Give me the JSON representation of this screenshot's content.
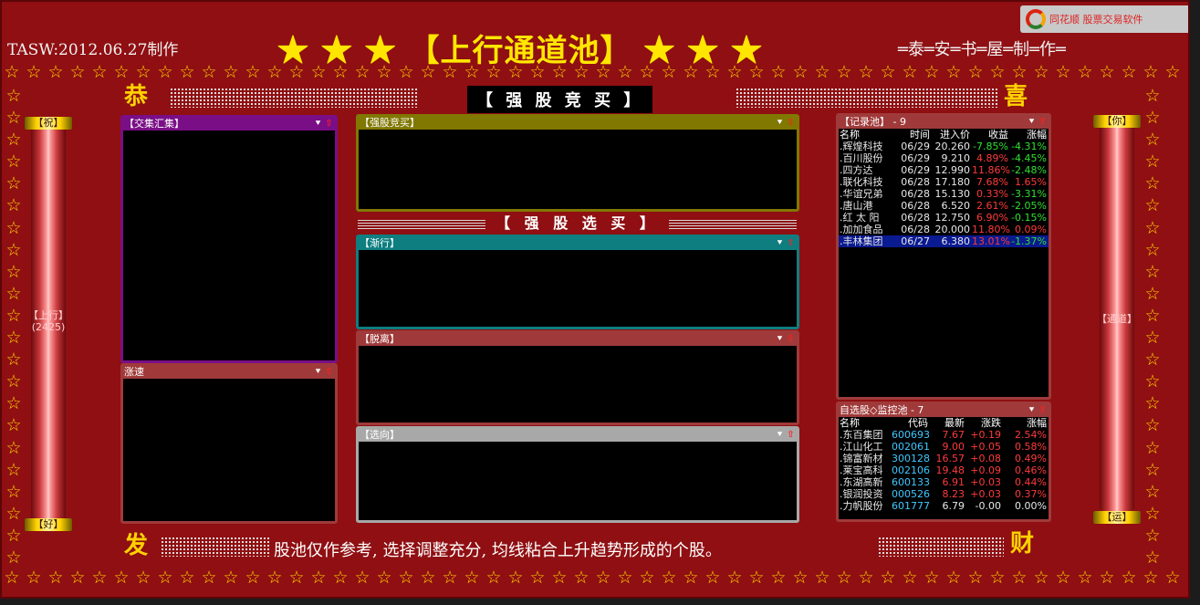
{
  "header": {
    "left_text": "TASW:2012.06.27制作",
    "title": "★ ★ ★ 【上行通道池】 ★ ★ ★",
    "right_text": "═泰═安═书═屋═制═作═",
    "logo_text": "同花顺 股票交易软件"
  },
  "corners": {
    "top_left": "恭",
    "top_right": "喜",
    "bottom_left": "发",
    "bottom_right": "财"
  },
  "badge_top": "【 强 股 竞 买 】",
  "selection_title": "【 强 股 选 买 】",
  "bottom_text": "股池仅作参考, 选择调整充分, 均线粘合上升趋势形成的个股。",
  "left_pillar": {
    "top_cap": "【祝】",
    "bottom_cap": "【好】",
    "label": "【上行】",
    "count": "(2425)"
  },
  "right_pillar": {
    "top_cap": "【你】",
    "bottom_cap": "【运】",
    "label": "【通道】"
  },
  "panels": {
    "jiaoji": "【交集汇集】",
    "zhangsu": "涨速",
    "qianggu": "【强股竞买】",
    "jianxing": "【渐行】",
    "tuoli": "【脱离】",
    "xuanxiang": "【选向】"
  },
  "record_pool": {
    "title": "【记录池】 - 9",
    "columns": [
      "名称",
      "时间",
      "进入价",
      "收益",
      "涨幅"
    ],
    "rows": [
      {
        "name": ".辉煌科技",
        "time": "06/29",
        "price": "20.260",
        "gain": "-7.85%",
        "change": "-4.31%",
        "gain_color": "grn",
        "change_color": "grn"
      },
      {
        "name": ".百川股份",
        "time": "06/29",
        "price": "9.210",
        "gain": "4.89%",
        "change": "-4.45%",
        "gain_color": "red",
        "change_color": "grn"
      },
      {
        "name": ".四方达",
        "time": "06/29",
        "price": "12.990",
        "gain": "11.86%",
        "change": "-2.48%",
        "gain_color": "red",
        "change_color": "grn"
      },
      {
        "name": ".联化科技",
        "time": "06/28",
        "price": "17.180",
        "gain": "7.68%",
        "change": "1.65%",
        "gain_color": "red",
        "change_color": "red"
      },
      {
        "name": ".华谊兄弟",
        "time": "06/28",
        "price": "15.130",
        "gain": "0.33%",
        "change": "-3.31%",
        "gain_color": "red",
        "change_color": "grn"
      },
      {
        "name": ".唐山港",
        "time": "06/28",
        "price": "6.520",
        "gain": "2.61%",
        "change": "-2.05%",
        "gain_color": "red",
        "change_color": "grn"
      },
      {
        "name": ".红 太 阳",
        "time": "06/28",
        "price": "12.750",
        "gain": "6.90%",
        "change": "-0.15%",
        "gain_color": "red",
        "change_color": "grn"
      },
      {
        "name": ".加加食品",
        "time": "06/28",
        "price": "20.000",
        "gain": "11.80%",
        "change": "0.09%",
        "gain_color": "red",
        "change_color": "red"
      },
      {
        "name": ".丰林集团",
        "time": "06/27",
        "price": "6.380",
        "gain": "13.01%",
        "change": "-1.37%",
        "gain_color": "red",
        "change_color": "grn"
      }
    ]
  },
  "watch_pool": {
    "title": "自选股◇监控池 - 7",
    "columns": [
      "名称",
      "代码",
      "最新",
      "涨跌",
      "涨幅"
    ],
    "rows": [
      {
        "name": ".东百集团",
        "code": "600693",
        "last": "7.67",
        "delta": "+0.19",
        "change": "2.54%"
      },
      {
        "name": ".江山化工",
        "code": "002061",
        "last": "9.00",
        "delta": "+0.05",
        "change": "0.58%"
      },
      {
        "name": ".锦富新材",
        "code": "300128",
        "last": "16.57",
        "delta": "+0.08",
        "change": "0.49%"
      },
      {
        "name": ".莱宝高科",
        "code": "002106",
        "last": "19.48",
        "delta": "+0.09",
        "change": "0.46%"
      },
      {
        "name": ".东湖高新",
        "code": "600133",
        "last": "6.91",
        "delta": "+0.03",
        "change": "0.44%"
      },
      {
        "name": ".银润投资",
        "code": "000526",
        "last": "8.23",
        "delta": "+0.03",
        "change": "0.37%"
      },
      {
        "name": ".力帆股份",
        "code": "601777",
        "last": "6.79",
        "delta": "-0.00",
        "change": "0.00%"
      }
    ]
  },
  "colors": {
    "board": "#8f0f12",
    "gold": "#ffd200",
    "purple": "#7a0e86",
    "olive": "#807800",
    "teal": "#0e7e80",
    "brown": "#a03a3a",
    "grey": "#a8a8a8"
  }
}
